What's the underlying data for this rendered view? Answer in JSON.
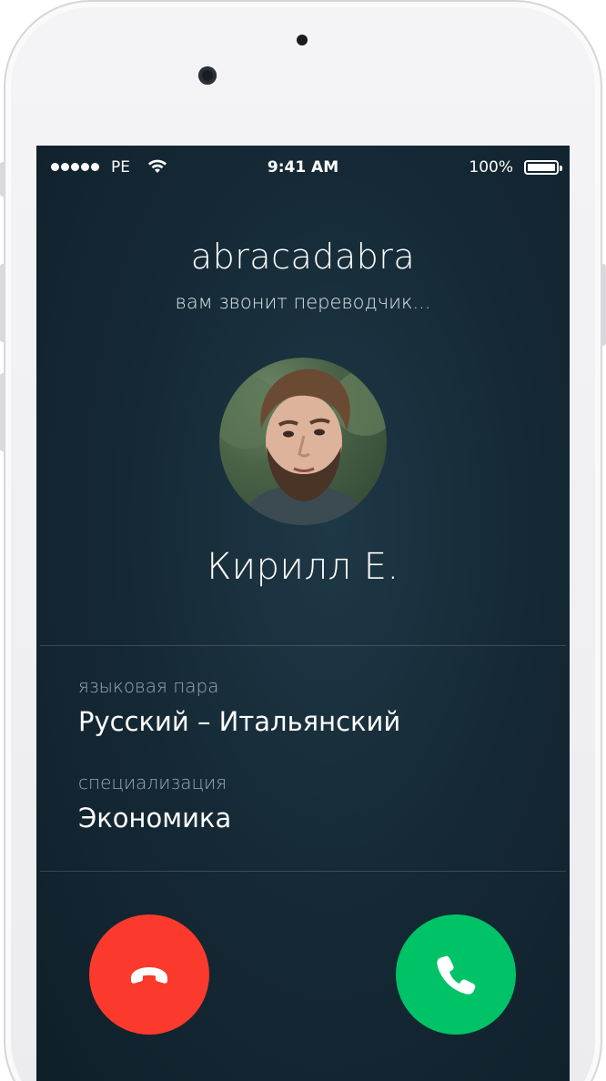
{
  "status_bar": {
    "carrier": "PE",
    "time": "9:41 AM",
    "battery": "100%"
  },
  "call": {
    "app_name": "abracadabra",
    "status": "вам звонит переводчик...",
    "caller_name": "Кирилл Е."
  },
  "details": {
    "language_pair_label": "языковая пара",
    "language_pair_value": "Русский – Итальянский",
    "specialization_label": "специализация",
    "specialization_value": "Экономика"
  },
  "actions": {
    "decline_icon": "phone-hangup-icon",
    "accept_icon": "phone-icon",
    "decline_color": "#fb3a2d",
    "accept_color": "#00c266"
  }
}
